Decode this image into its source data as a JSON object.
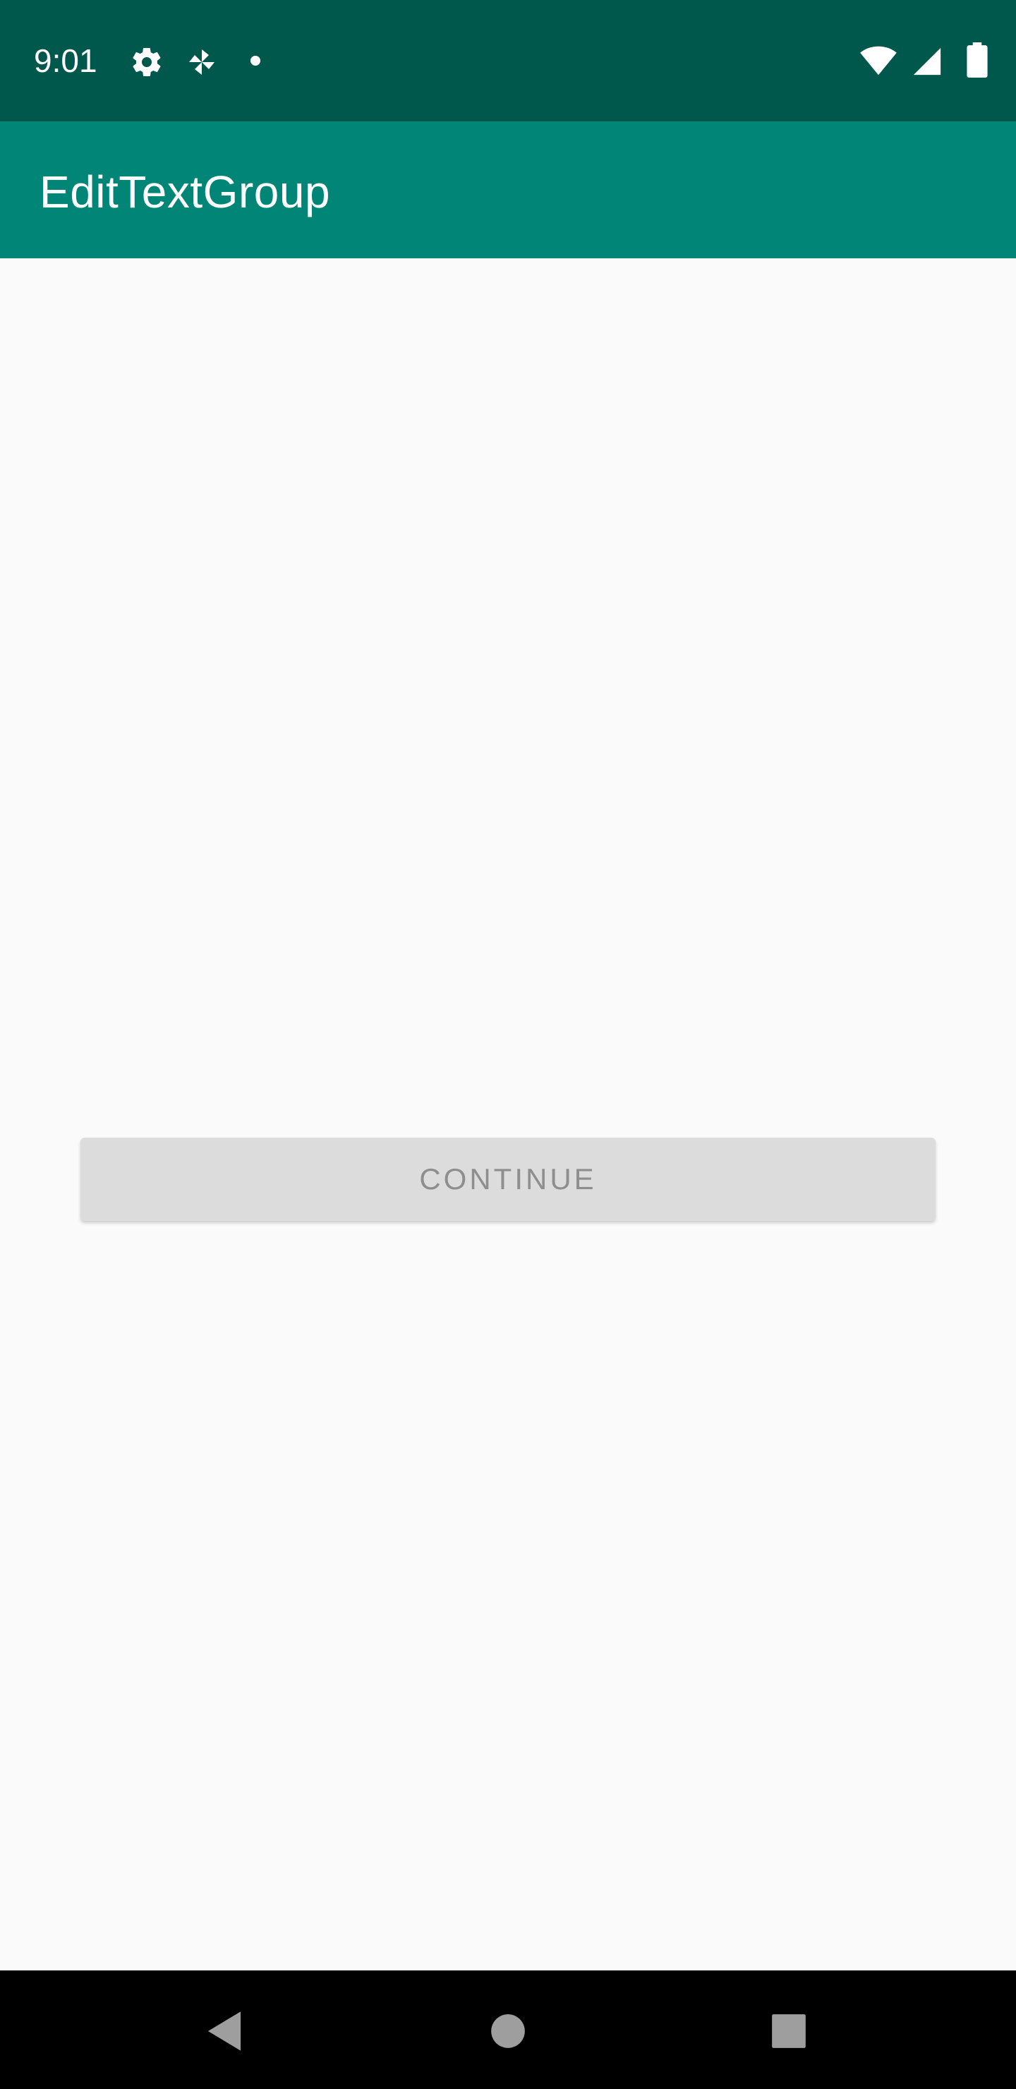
{
  "status_bar": {
    "time": "9:01",
    "icons_left": [
      "gear-icon",
      "pinwheel-icon",
      "notification-dot-icon"
    ],
    "icons_right": [
      "wifi-icon",
      "cellular-signal-icon",
      "battery-icon"
    ]
  },
  "app_bar": {
    "title": "EditTextGroup"
  },
  "code_inputs": [
    {
      "value": "",
      "focused": true
    },
    {
      "value": "",
      "focused": false
    },
    {
      "value": "",
      "focused": false
    },
    {
      "value": "",
      "focused": false
    }
  ],
  "continue_button": {
    "label": "CONTINUE",
    "enabled": false
  },
  "nav_bar": {
    "buttons": [
      "back-icon",
      "home-icon",
      "recents-icon"
    ]
  },
  "colors": {
    "status_bar": "#00574b",
    "app_bar": "#008577",
    "accent": "#d81b60",
    "button_disabled_bg": "#dcdcdc",
    "button_disabled_text": "#8e8e8e"
  }
}
